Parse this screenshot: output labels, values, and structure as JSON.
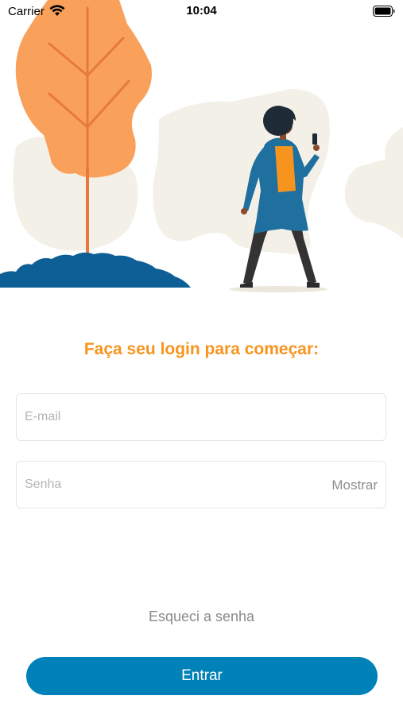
{
  "status_bar": {
    "carrier": "Carrier",
    "time": "10:04",
    "wifi_icon": "wifi-icon",
    "battery_icon": "battery-icon"
  },
  "illustration": {
    "description_icon": "woman-walking-with-phone-illustration"
  },
  "login": {
    "title": "Faça seu login para começar:",
    "email_placeholder": "E-mail",
    "email_value": "",
    "password_placeholder": "Senha",
    "password_value": "",
    "show_password_label": "Mostrar",
    "forgot_password_label": "Esqueci a senha",
    "submit_label": "Entrar"
  },
  "colors": {
    "accent_orange": "#f7941d",
    "primary_blue": "#0081b7",
    "tree_orange": "#f9a05b",
    "blob_beige": "#f3f0e8",
    "grass_blue": "#0d5f95"
  }
}
